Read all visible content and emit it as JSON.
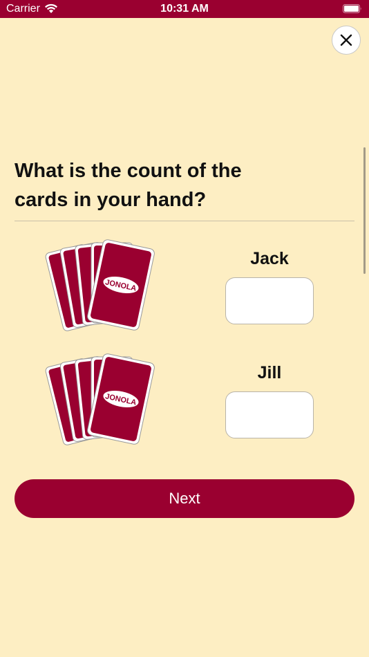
{
  "status_bar": {
    "carrier": "Carrier",
    "time": "10:31 AM",
    "icons": [
      "wifi-icon",
      "battery-icon"
    ]
  },
  "close": {
    "icon": "close-icon"
  },
  "question": "What is the count of the cards in your hand?",
  "card_logo": "JONOLA",
  "players": [
    {
      "name": "Jack",
      "count_value": ""
    },
    {
      "name": "Jill",
      "count_value": ""
    }
  ],
  "next_label": "Next",
  "colors": {
    "accent": "#9a0030",
    "background": "#fdeec3",
    "card_back": "#9a0030",
    "input_bg": "#ffffff"
  }
}
